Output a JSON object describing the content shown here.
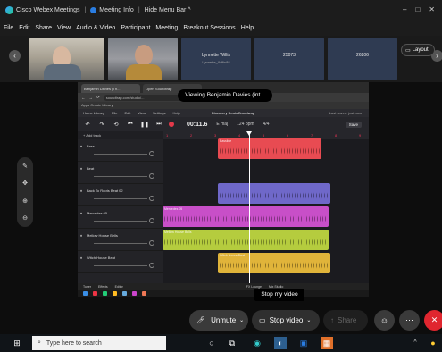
{
  "webex": {
    "app_title": "Cisco Webex Meetings",
    "meeting_info": "Meeting Info",
    "hide_menu_bar": "Hide Menu Bar ^",
    "menu": [
      "File",
      "Edit",
      "Share",
      "View",
      "Audio & Video",
      "Participant",
      "Meeting",
      "Breakout Sessions",
      "Help"
    ]
  },
  "participants": [
    {
      "name": "",
      "type": "video-a"
    },
    {
      "name": "",
      "type": "video-b"
    },
    {
      "name": "Lynnette Willis",
      "sub": "Lynnette_Willis88",
      "type": "tile"
    },
    {
      "name": "25073",
      "type": "tile"
    },
    {
      "name": "26206",
      "type": "tile"
    }
  ],
  "layout_label": "Layout",
  "share": {
    "viewing_label": "Viewing Benjamin Davies (int...",
    "tabs": [
      "Benjamin Davies (Th...",
      "Open Soundtrap"
    ],
    "url": "soundtrap.com/studio/...",
    "bookmarks": "Apps  Create  Library",
    "studio_menu": [
      "Home Library",
      "File",
      "Edit",
      "View",
      "Settings",
      "Help"
    ],
    "project_title": "Discovery Beats Broadway",
    "last_saved": "Last saved: just now",
    "time": "00:11.6",
    "key": "E maj",
    "tempo": "124 bpm",
    "meter": "4/4",
    "save_label": "Save",
    "add_track": "+ Add track",
    "tracks": [
      {
        "name": "Bass",
        "clips": [
          {
            "label": "Bassline",
            "color": "#e84b52"
          }
        ]
      },
      {
        "name": "Beat",
        "clips": []
      },
      {
        "name": "Back To Roots Beat 02",
        "clips": [
          {
            "label": "",
            "color": "#6f68c9"
          }
        ]
      },
      {
        "name": "Mercedes 05",
        "clips": [
          {
            "label": "Mercedes 05",
            "color": "#c84fc8"
          }
        ]
      },
      {
        "name": "Mellow House Bells",
        "clips": [
          {
            "label": "Mellow House Bells",
            "color": "#b5cc3e"
          }
        ]
      },
      {
        "name": "Witch House Beat",
        "clips": [
          {
            "label": "Witch House Beat",
            "color": "#e0b43a"
          }
        ]
      }
    ],
    "ruler_marks": [
      "1",
      "2",
      "3",
      "4",
      "5",
      "6",
      "7",
      "8",
      "9"
    ],
    "bottom_bar": [
      "Tuner",
      "Effects",
      "Editor",
      "FX Lounge",
      "Mix Studio"
    ]
  },
  "tooltip": "Stop my video",
  "controls": {
    "unmute": "Unmute",
    "stop_video": "Stop video",
    "share": "Share"
  },
  "taskbar": {
    "search_placeholder": "Type here to search",
    "clock_time": "8:17 AM",
    "clock_date": "3/8/2021"
  },
  "colors": {
    "accent": "#2a7de1",
    "end_call": "#e0262f"
  }
}
